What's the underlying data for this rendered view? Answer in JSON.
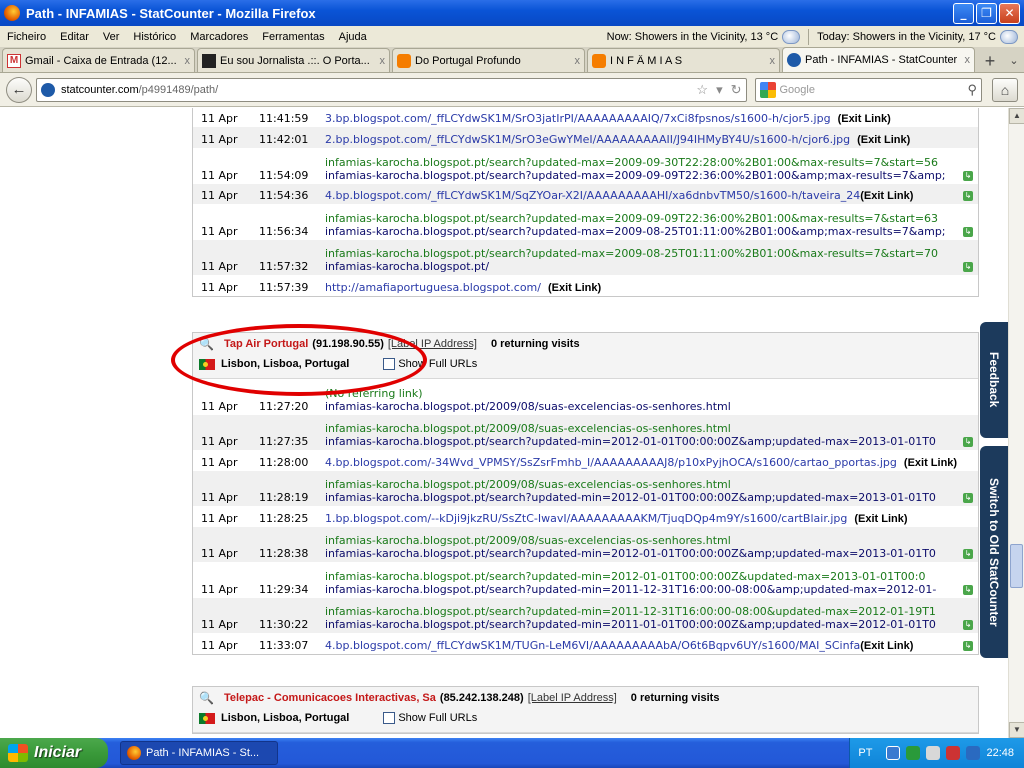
{
  "window": {
    "title": "Path - INFAMIAS - StatCounter - Mozilla Firefox",
    "minimize": "_",
    "restore": "❐",
    "close": "✕"
  },
  "menu": {
    "items": [
      "Ficheiro",
      "Editar",
      "Ver",
      "Histórico",
      "Marcadores",
      "Ferramentas",
      "Ajuda"
    ],
    "weather_now": "Now: Showers in the Vicinity, 13 °C",
    "weather_today": "Today: Showers in the Vicinity, 17 °C"
  },
  "tabs": [
    {
      "label": "Gmail - Caixa de Entrada (12...",
      "icon": "gmail-icon"
    },
    {
      "label": "Eu sou Jornalista .::. O Porta...",
      "icon": "site-icon"
    },
    {
      "label": "Do Portugal Profundo",
      "icon": "blogger-icon"
    },
    {
      "label": "I N F Â M I A S",
      "icon": "blogger-icon"
    },
    {
      "label": "Path - INFAMIAS - StatCounter",
      "icon": "statcounter-icon"
    }
  ],
  "tab_close": "x",
  "new_tab": "+",
  "nav": {
    "back": "←",
    "url_host": "statcounter.com",
    "url_path": "/p4991489/path/",
    "search_placeholder": "Google",
    "home": "⌂"
  },
  "exit_link": "(Exit Link)",
  "top_rows": [
    {
      "date": "11 Apr",
      "time": "11:41:59",
      "page": "3.bp.blogspot.com/_ffLCYdwSK1M/SrO3jatIrPI/AAAAAAAAAIQ/7xCi8fpsnos/s1600-h/cjor5.jpg",
      "exit": true
    },
    {
      "date": "11 Apr",
      "time": "11:42:01",
      "page": "2.bp.blogspot.com/_ffLCYdwSK1M/SrO3eGwYMeI/AAAAAAAAAII/J94IHMyBY4U/s1600-h/cjor6.jpg",
      "exit": true
    },
    {
      "date": "11 Apr",
      "time": "11:54:09",
      "ref": "infamias-karocha.blogspot.pt/search?updated-max=2009-09-30T22:28:00%2B01:00&max-results=7&start=56",
      "page": "infamias-karocha.blogspot.pt/search?updated-max=2009-09-09T22:36:00%2B01:00&amp;max-results=7&amp;"
    },
    {
      "date": "11 Apr",
      "time": "11:54:36",
      "page": "4.bp.blogspot.com/_ffLCYdwSK1M/SqZYOar-X2I/AAAAAAAAAHI/xa6dnbvTM50/s1600-h/taveira_24",
      "exit": true
    },
    {
      "date": "11 Apr",
      "time": "11:56:34",
      "ref": "infamias-karocha.blogspot.pt/search?updated-max=2009-09-09T22:36:00%2B01:00&max-results=7&start=63",
      "page": "infamias-karocha.blogspot.pt/search?updated-max=2009-08-25T01:11:00%2B01:00&amp;max-results=7&amp;"
    },
    {
      "date": "11 Apr",
      "time": "11:57:32",
      "ref": "infamias-karocha.blogspot.pt/search?updated-max=2009-08-25T01:11:00%2B01:00&max-results=7&start=70",
      "page": "infamias-karocha.blogspot.pt/"
    },
    {
      "date": "11 Apr",
      "time": "11:57:39",
      "page": "http://amafiaportuguesa.blogspot.com/",
      "exit": true,
      "link": true
    }
  ],
  "visitor1": {
    "org": "Tap Air Portugal",
    "ip": "(91.198.90.55)",
    "label_ip": "[Label IP Address]",
    "returning": "0 returning visits",
    "location": "Lisbon, Lisboa, Portugal",
    "show_full": "Show Full URLs",
    "rows": [
      {
        "date": "11 Apr",
        "time": "11:27:20",
        "ref": "(No referring link)",
        "page": "infamias-karocha.blogspot.pt/2009/08/suas-excelencias-os-senhores.html"
      },
      {
        "date": "11 Apr",
        "time": "11:27:35",
        "ref": "infamias-karocha.blogspot.pt/2009/08/suas-excelencias-os-senhores.html",
        "page": "infamias-karocha.blogspot.pt/search?updated-min=2012-01-01T00:00:00Z&amp;updated-max=2013-01-01T0"
      },
      {
        "date": "11 Apr",
        "time": "11:28:00",
        "page": "4.bp.blogspot.com/-34Wvd_VPMSY/SsZsrFmhb_I/AAAAAAAAAJ8/p10xPyjhOCA/s1600/cartao_pportas.jpg",
        "exit": true
      },
      {
        "date": "11 Apr",
        "time": "11:28:19",
        "ref": "infamias-karocha.blogspot.pt/2009/08/suas-excelencias-os-senhores.html",
        "page": "infamias-karocha.blogspot.pt/search?updated-min=2012-01-01T00:00:00Z&amp;updated-max=2013-01-01T0"
      },
      {
        "date": "11 Apr",
        "time": "11:28:25",
        "page": "1.bp.blogspot.com/--kDji9jkzRU/SsZtC-IwavI/AAAAAAAAAKM/TjuqDQp4m9Y/s1600/cartBlair.jpg",
        "exit": true
      },
      {
        "date": "11 Apr",
        "time": "11:28:38",
        "ref": "infamias-karocha.blogspot.pt/2009/08/suas-excelencias-os-senhores.html",
        "page": "infamias-karocha.blogspot.pt/search?updated-min=2012-01-01T00:00:00Z&amp;updated-max=2013-01-01T0"
      },
      {
        "date": "11 Apr",
        "time": "11:29:34",
        "ref": "infamias-karocha.blogspot.pt/search?updated-min=2012-01-01T00:00:00Z&updated-max=2013-01-01T00:0",
        "page": "infamias-karocha.blogspot.pt/search?updated-min=2011-12-31T16:00:00-08:00&amp;updated-max=2012-01-"
      },
      {
        "date": "11 Apr",
        "time": "11:30:22",
        "ref": "infamias-karocha.blogspot.pt/search?updated-min=2011-12-31T16:00:00-08:00&updated-max=2012-01-19T1",
        "page": "infamias-karocha.blogspot.pt/search?updated-min=2011-01-01T00:00:00Z&amp;updated-max=2012-01-01T0"
      },
      {
        "date": "11 Apr",
        "time": "11:33:07",
        "page": "4.bp.blogspot.com/_ffLCYdwSK1M/TUGn-LeM6VI/AAAAAAAAAbA/O6t6Bqpv6UY/s1600/MAI_SCinfa",
        "exit": true
      }
    ]
  },
  "visitor2": {
    "org": "Telepac - Comunicacoes Interactivas, Sa",
    "ip": "(85.242.138.248)",
    "label_ip": "[Label IP Address]",
    "returning": "0 returning visits",
    "location": "Lisbon, Lisboa, Portugal",
    "show_full": "Show Full URLs"
  },
  "side_tabs": {
    "feedback": "Feedback",
    "switch": "Switch to Old StatCounter"
  },
  "taskbar": {
    "start": "Iniciar",
    "task": "Path - INFAMIAS - St...",
    "lang": "PT",
    "clock": "22:48"
  }
}
